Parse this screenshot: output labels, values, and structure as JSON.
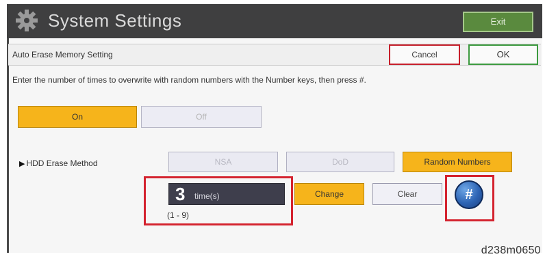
{
  "header": {
    "title": "System Settings",
    "exit_label": "Exit"
  },
  "subheader": {
    "title": "Auto Erase Memory Setting",
    "cancel_label": "Cancel",
    "ok_label": "OK"
  },
  "instruction": "Enter the number of times to overwrite with random numbers with the Number keys, then press #.",
  "on_off": {
    "on_label": "On",
    "off_label": "Off",
    "selected": "On"
  },
  "hdd_erase": {
    "label": "HDD Erase Method",
    "options": [
      "NSA",
      "DoD",
      "Random Numbers"
    ],
    "selected": "Random Numbers"
  },
  "times": {
    "value": "3",
    "unit": "time(s)",
    "range": "(1 - 9)",
    "change_label": "Change",
    "clear_label": "Clear",
    "enter_key_label": "#"
  },
  "figure_id": "d238m0650",
  "colors": {
    "header_bg": "#3f3f40",
    "selected_yellow": "#f6b41b",
    "highlight_red": "#d4232f",
    "ok_green": "#3c9a3f"
  },
  "icons": {
    "header": "gear-icon",
    "hdd_label_marker": "triangle-right-icon"
  }
}
